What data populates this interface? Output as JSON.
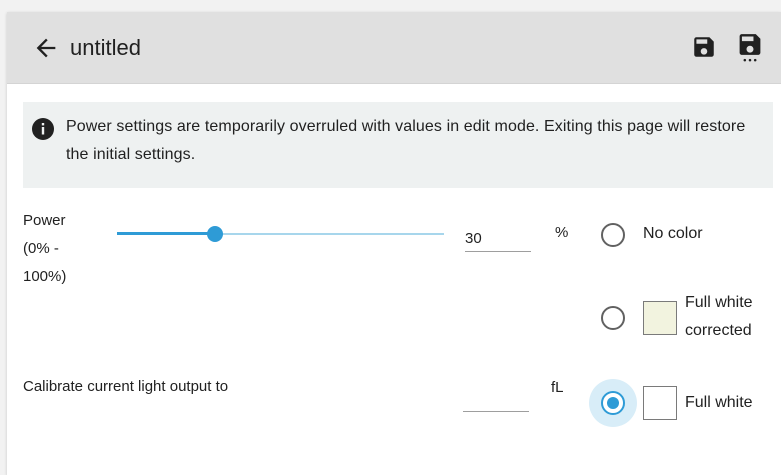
{
  "header": {
    "back_icon": "arrow-left-icon",
    "title": "untitled",
    "save_icon": "floppy-disk-icon",
    "save_as_icon": "floppy-disk-more-icon"
  },
  "info": {
    "icon": "info-circle-icon",
    "text": "Power settings are temporarily overruled with values in edit mode. Exiting this page will restore the initial settings."
  },
  "power": {
    "label": "Power (0% - 100%)",
    "value": "30",
    "slider_percent": 30,
    "unit": "%"
  },
  "calibrate": {
    "label": "Calibrate current light output to",
    "value": "",
    "unit": "fL"
  },
  "color_options": [
    {
      "label": "No color",
      "selected": false,
      "swatch": null
    },
    {
      "label": "Full white corrected",
      "selected": false,
      "swatch": "#f2f3df"
    },
    {
      "label": "Full white",
      "selected": true,
      "swatch": "#ffffff"
    }
  ],
  "colors": {
    "accent": "#2e9bd6",
    "slider_track": "#a7d6ec",
    "header_bg": "#e0e0e0",
    "info_bg": "#eef1f1"
  }
}
